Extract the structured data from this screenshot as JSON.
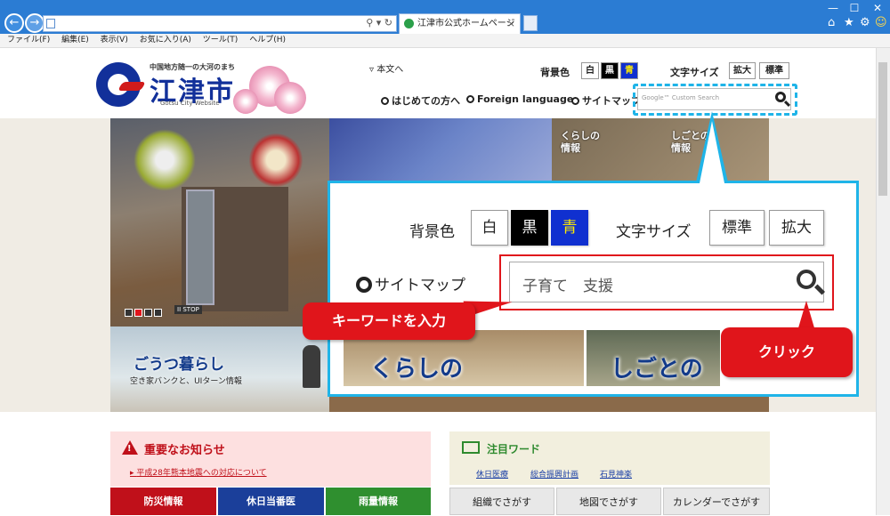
{
  "browser": {
    "tab_title": "江津市公式ホームページ",
    "menu": [
      "ファイル(F)",
      "編集(E)",
      "表示(V)",
      "お気に入り(A)",
      "ツール(T)",
      "ヘルプ(H)"
    ],
    "win_controls": [
      "—",
      "☐",
      "✕"
    ],
    "toolbar_icons": [
      "home-icon",
      "star-icon",
      "gear-icon",
      "smiley-icon"
    ]
  },
  "site": {
    "tagline": "中国地方随一の大河のまち",
    "name": "江津市",
    "name_en": "Gotsu City Website",
    "skip_link": "本文へ",
    "bg_label": "背景色",
    "bg_options": [
      "白",
      "黒",
      "青"
    ],
    "font_label": "文字サイズ",
    "font_options": [
      "拡大",
      "標準"
    ],
    "nav": [
      "はじめての方へ",
      "Foreign language",
      "サイトマップ"
    ],
    "search_placeholder": "Google™ Custom Search"
  },
  "hero": {
    "tile_kurashi": "くらしの\n情報",
    "tile_shigoto": "しごとの\n情報",
    "stop_label": "STOP",
    "feature_title": "ごうつ暮らし",
    "feature_sub": "空き家バンクと、UIターン情報"
  },
  "notice": {
    "title": "重要なお知らせ",
    "link": "平成28年熊本地震への対応について",
    "buttons": [
      "防災情報",
      "休日当番医",
      "雨量情報"
    ],
    "button_colors": [
      "#c0101a",
      "#1b3f9a",
      "#2f8f2f"
    ]
  },
  "words": {
    "title": "注目ワード",
    "links": [
      "休日医療",
      "総合振興計画",
      "石見神楽"
    ],
    "buttons": [
      "組織でさがす",
      "地図でさがす",
      "カレンダーでさがす"
    ]
  },
  "callout": {
    "bg_label": "背景色",
    "bg_options": [
      "白",
      "黒",
      "青"
    ],
    "font_label": "文字サイズ",
    "font_options": [
      "標準",
      "拡大"
    ],
    "sitemap": "サイトマップ",
    "search_text": "子育て　支援",
    "tile_left": "くらしの",
    "tile_right": "しごとの",
    "bubble_keyword": "キーワードを入力",
    "bubble_click": "クリック"
  }
}
